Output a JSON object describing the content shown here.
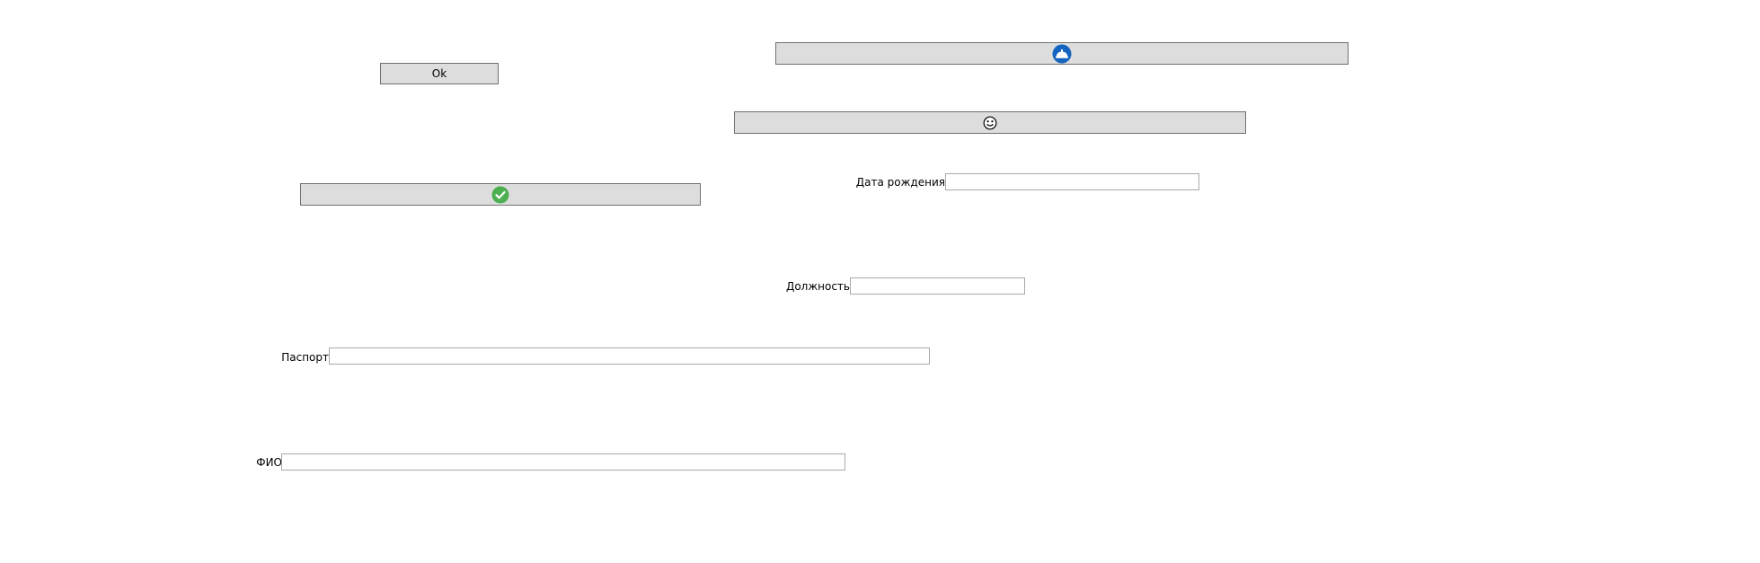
{
  "buttons": {
    "ok": {
      "label": "Ok"
    },
    "blue_icon_button": {
      "icon": "hat-icon",
      "color": "#1565c0"
    },
    "smiley_button": {
      "icon": "smiley-face-icon"
    },
    "check_button": {
      "icon": "checkmark-icon",
      "color": "#4caf50"
    }
  },
  "fields": {
    "birth_date": {
      "label": "Дата рождения",
      "value": ""
    },
    "position": {
      "label": "Должность",
      "value": ""
    },
    "passport": {
      "label": "Паспорт",
      "value": ""
    },
    "full_name": {
      "label": "ФИО",
      "value": ""
    }
  },
  "colors": {
    "button_face": "#dddddd",
    "button_border": "#707070",
    "field_border": "#a9a9a9"
  }
}
